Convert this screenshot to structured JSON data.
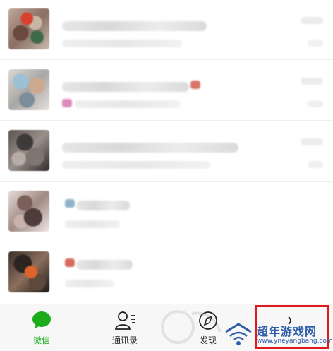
{
  "tabbar": {
    "tabs": [
      {
        "label": "微信",
        "icon": "chat-bubble-icon",
        "active": true
      },
      {
        "label": "通讯录",
        "icon": "contacts-icon",
        "active": false
      },
      {
        "label": "发现",
        "icon": "compass-icon",
        "active": false
      },
      {
        "label": "",
        "icon": "me-icon",
        "active": false
      }
    ]
  },
  "watermark": {
    "name": "超年游戏网",
    "url": "www.yneyangbang.com"
  },
  "colors": {
    "active": "#1aad19",
    "highlight": "#e0191d",
    "watermark": "#2f5da8"
  }
}
